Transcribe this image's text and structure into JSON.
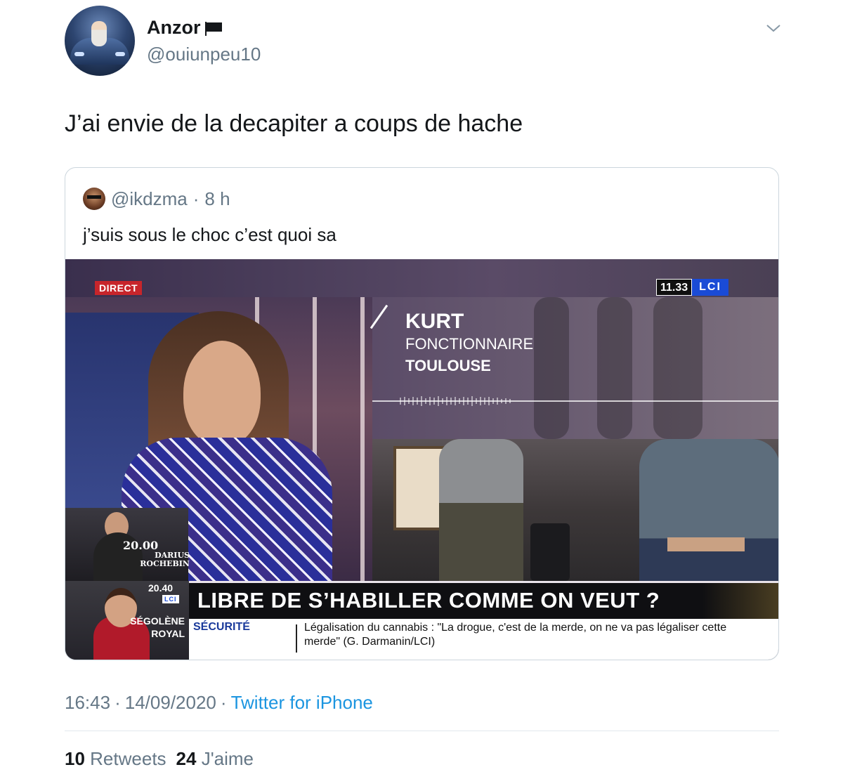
{
  "author": {
    "display_name": "Anzor",
    "handle": "@ouiunpeu10",
    "avatar_icon": "car-avatar",
    "name_emoji_icon": "black-flag-icon"
  },
  "menu_icon": "chevron-down-icon",
  "tweet_text": "J’ai envie de la decapiter a coups de hache",
  "quoted_tweet": {
    "handle": "@ikdzma",
    "separator": "·",
    "age": "8 h",
    "text": "j’suis sous le choc c’est quoi sa",
    "video_frame": {
      "live_badge": "DIRECT",
      "clock": "11.33",
      "channel_logo": "LCI",
      "guest_name": "KURT",
      "guest_job": "FONCTIONNAIRE",
      "guest_city": "TOULOUSE",
      "promo_top_time": "20.00",
      "promo_top_name_line1": "DARIUS",
      "promo_top_name_line2": "ROCHEBIN",
      "promo_bottom_time": "20.40",
      "promo_bottom_logo": "LCI",
      "promo_bottom_name_line1": "SÉGOLÈNE",
      "promo_bottom_name_line2": "ROYAL",
      "headline": "LIBRE DE S’HABILLER COMME ON VEUT ?",
      "ticker_section": "SÉCURITÉ",
      "ticker_text": "Légalisation du cannabis : \"La drogue, c'est de la merde, on ne va pas légaliser cette merde\" (G. Darmanin/LCI)"
    }
  },
  "footer": {
    "time": "16:43",
    "dot1": "·",
    "date": "14/09/2020",
    "dot2": "·",
    "source": "Twitter for iPhone",
    "retweets_count": "10",
    "retweets_label": "Retweets",
    "likes_count": "24",
    "likes_label": "J'aime"
  },
  "colors": {
    "link": "#1b95e0",
    "secondary_text": "#657786",
    "lci_blue": "#1a4bd6",
    "direct_red": "#c7252b"
  }
}
